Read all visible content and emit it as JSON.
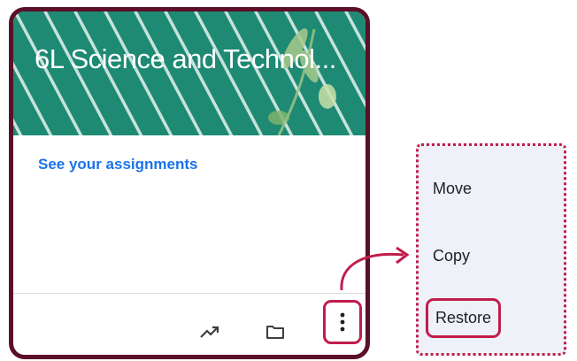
{
  "card": {
    "title": "6L Science and Technol...",
    "link_text": "See your assignments",
    "icons": [
      "trending-up-icon",
      "folder-icon",
      "more-vert-icon"
    ],
    "colors": {
      "banner": "#1e8a74",
      "frame": "#5b0f28",
      "highlight": "#c01d4b",
      "link": "#1a73e8"
    }
  },
  "menu": {
    "items": [
      "Move",
      "Copy",
      "Restore"
    ]
  }
}
